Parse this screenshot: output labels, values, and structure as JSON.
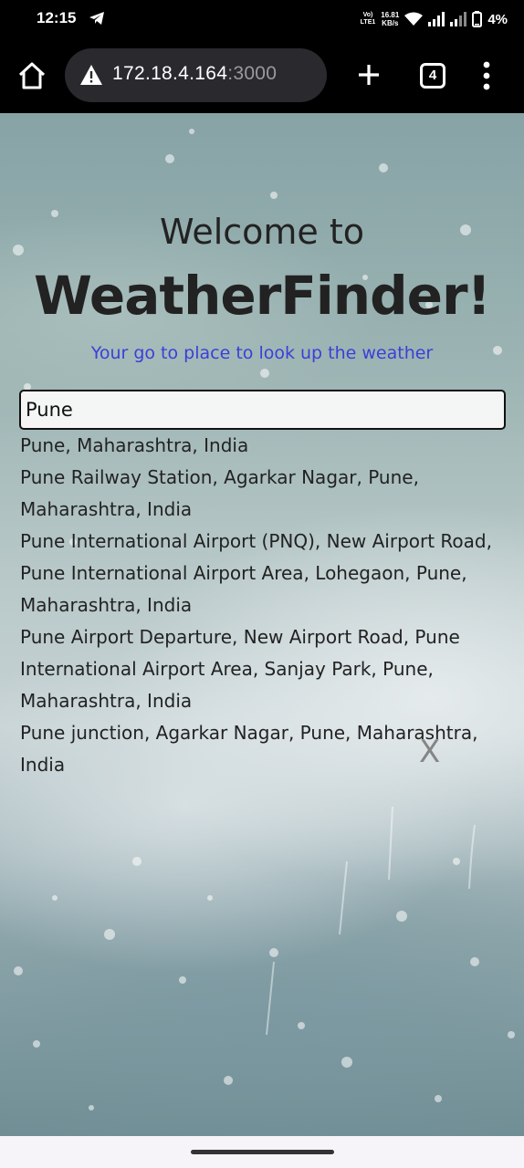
{
  "status_bar": {
    "time": "12:15",
    "volte_line1": "Vo)",
    "volte_line2": "LTE1",
    "speed_value": "16.81",
    "speed_unit": "KB/s",
    "battery": "4%"
  },
  "browser": {
    "url_host": "172.18.4.164",
    "url_port": ":3000",
    "tab_count": "4"
  },
  "page": {
    "welcome": "Welcome to",
    "brand": "WeatherFinder!",
    "tagline": "Your go to place to look up the weather"
  },
  "search": {
    "value": "Pune",
    "suggestions": [
      "Pune, Maharashtra, India",
      "Pune Railway Station, Agarkar Nagar, Pune, Maharashtra, India",
      "Pune International Airport (PNQ), New Airport Road, Pune International Airport Area, Lohegaon, Pune, Maharashtra, India",
      "Pune Airport Departure, New Airport Road, Pune International Airport Area, Sanjay Park, Pune, Maharashtra, India",
      "Pune junction, Agarkar Nagar, Pune, Maharashtra, India"
    ],
    "clear_label": "X"
  },
  "icons": {
    "telegram": "telegram-icon",
    "home": "home-icon",
    "warning": "warning-icon",
    "plus": "plus-icon",
    "tabs": "tabs-icon",
    "menu": "more-vert-icon"
  },
  "colors": {
    "tagline": "#3b3fd8",
    "toolbar": "#000000",
    "url_bar": "#2a2a2e"
  }
}
